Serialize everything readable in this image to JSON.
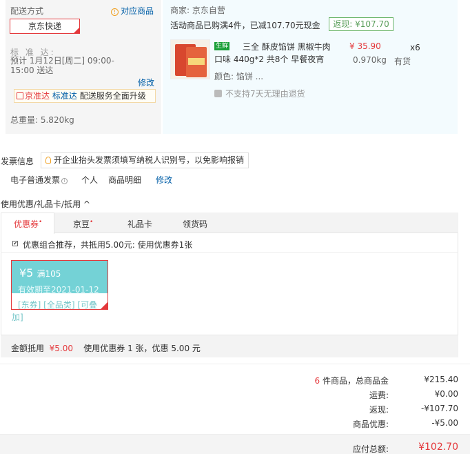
{
  "delivery": {
    "title": "配送方式",
    "corresponding_goods": "对应商品",
    "method": "京东快递",
    "standard_label": "标 准 达:",
    "estimate": "预计 1月12日[周二] 09:00-15:00 送达",
    "modify": "修改",
    "banner_a": "京准达",
    "banner_b": "标准达",
    "banner_c": "配送服务全面升级",
    "total_weight": "总重量: 5.820kg"
  },
  "merchant": {
    "name": "商家: 京东自营",
    "promo": "活动商品已购满4件，已减107.70元现金",
    "cashback": "返现: ¥107.70"
  },
  "product": {
    "fresh_tag": "生鲜",
    "name_line1": "三全 酥皮馅饼 黑椒牛肉",
    "name_line2": "口味 440g*2 共8个 早餐夜宵",
    "price": "¥ 35.90",
    "quantity": "x6",
    "weight": "0.970kg",
    "stock": "有货",
    "color": "颜色: 馅饼 ...",
    "no_return": "不支持7天无理由退货"
  },
  "invoice": {
    "title": "发票信息",
    "tip": "开企业抬头发票须填写纳税人识别号，以免影响报销",
    "type": "电子普通发票",
    "person": "个人",
    "detail": "商品明细",
    "modify": "修改"
  },
  "coupons": {
    "title": "使用优惠/礼品卡/抵用 ^",
    "tabs": {
      "coupon": "优惠券",
      "jingdou": "京豆",
      "giftcard": "礼品卡",
      "ticket": "领货码"
    },
    "combo_check": "✔",
    "combo_text": "优惠组合推荐，共抵用5.00元: 使用优惠券1张",
    "card": {
      "value": "¥5",
      "condition": "满105",
      "expire": "有效期至2021-01-12",
      "tags_line1": "[东券] [全品类] [可叠",
      "tags_line2": "加]"
    },
    "summary_label": "金额抵用",
    "summary_amount": "¥5.00",
    "summary_text": "使用优惠券 1 张，优惠 5.00 元"
  },
  "totals": {
    "count": "6",
    "count_suffix": "件商品，总商品金",
    "sum": "¥215.40",
    "shipping_label": "运费:",
    "shipping": "¥0.00",
    "discount_label": "返现:",
    "discount": "-¥107.70",
    "coupon_label": "商品优惠:",
    "coupon": "-¥5.00",
    "payable_label": "应付总额:",
    "payable": "¥102.70"
  }
}
